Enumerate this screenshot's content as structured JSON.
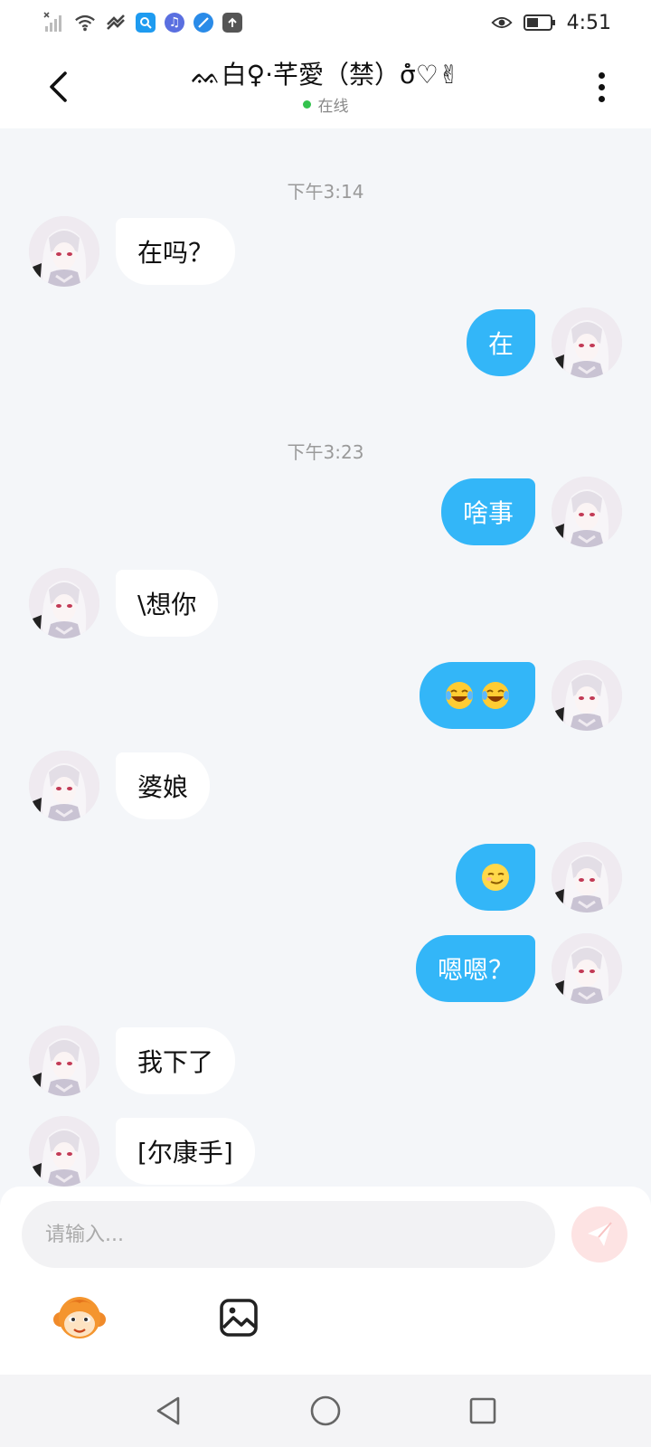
{
  "status_bar": {
    "time": "4:51",
    "icons": [
      "signal-icon",
      "wifi-icon",
      "data-sync-icon",
      "search-app-icon",
      "music-app-icon",
      "browser-app-icon",
      "upload-icon",
      "eye-icon",
      "battery-icon"
    ]
  },
  "header": {
    "contact_name": "ᨐ白♀·芊愛（禁）σໍໍ♡✌",
    "status": "在线",
    "status_color": "#33c24d"
  },
  "messages": [
    {
      "type": "timestamp",
      "text": "下午3:14"
    },
    {
      "type": "message",
      "side": "in",
      "text": "在吗？"
    },
    {
      "type": "message",
      "side": "out",
      "text": "在"
    },
    {
      "type": "timestamp",
      "text": "下午3:23"
    },
    {
      "type": "message",
      "side": "out",
      "text": "啥事"
    },
    {
      "type": "message",
      "side": "in",
      "text": "\\想你"
    },
    {
      "type": "message",
      "side": "out",
      "text": "",
      "emoji": [
        "laughing-tears-emoji",
        "laughing-tears-emoji"
      ]
    },
    {
      "type": "message",
      "side": "in",
      "text": "婆娘"
    },
    {
      "type": "message",
      "side": "out",
      "text": "",
      "emoji": [
        "smirk-emoji"
      ]
    },
    {
      "type": "message",
      "side": "out",
      "text": "嗯嗯？"
    },
    {
      "type": "message",
      "side": "in",
      "text": "我下了"
    },
    {
      "type": "message",
      "side": "in",
      "text": "[尔康手]"
    }
  ],
  "composer": {
    "placeholder": "请输入...",
    "send_icon": "send-icon",
    "tools": [
      "sticker-monkey-icon",
      "image-icon"
    ]
  },
  "colors": {
    "outgoing_bubble": "#33b6f8",
    "incoming_bubble": "#ffffff",
    "background": "#f4f6f9"
  },
  "nav": [
    "back-triangle-icon",
    "home-circle-icon",
    "recents-square-icon"
  ]
}
